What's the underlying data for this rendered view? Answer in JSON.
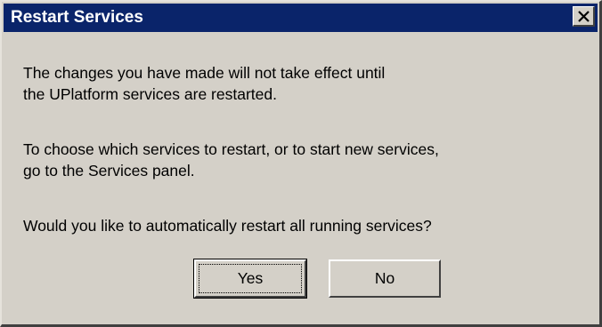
{
  "dialog": {
    "title": "Restart Services",
    "close_icon": "close-icon",
    "message_1": "The changes you have made will not take effect until\nthe UPlatform services are restarted.",
    "message_2": "To choose which services to restart, or to start new services,\ngo to the Services panel.",
    "message_3": "Would you like to automatically restart all running services?",
    "buttons": {
      "yes_label": "Yes",
      "no_label": "No"
    }
  },
  "colors": {
    "titlebar": "#0a246a",
    "face": "#d4d0c8",
    "text": "#000000"
  }
}
